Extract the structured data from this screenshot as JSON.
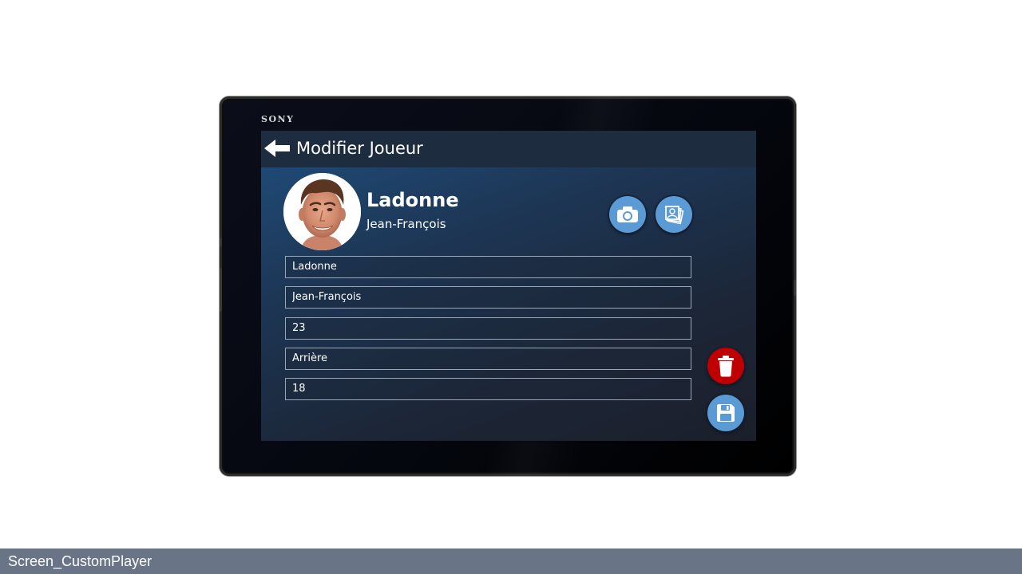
{
  "device": {
    "brand": "SONY"
  },
  "header": {
    "title": "Modifier Joueur",
    "back_icon": "arrow-left-icon"
  },
  "player": {
    "last_name": "Ladonne",
    "first_name": "Jean-François",
    "photo": "player-photo"
  },
  "actions": {
    "camera_icon": "camera-icon",
    "gallery_icon": "gallery-icon",
    "delete_icon": "trash-icon",
    "save_icon": "floppy-disk-icon"
  },
  "form": {
    "fields": [
      {
        "name": "last_name",
        "value": "Ladonne"
      },
      {
        "name": "first_name",
        "value": "Jean-François"
      },
      {
        "name": "number",
        "value": "23"
      },
      {
        "name": "position",
        "value": "Arrière"
      },
      {
        "name": "age",
        "value": "18"
      }
    ]
  },
  "colors": {
    "accent_blue": "#5b9bd5",
    "danger_red": "#c00000",
    "topbar": "#1e2c40",
    "footer": "#697587"
  },
  "footer": {
    "label": "Screen_CustomPlayer"
  }
}
